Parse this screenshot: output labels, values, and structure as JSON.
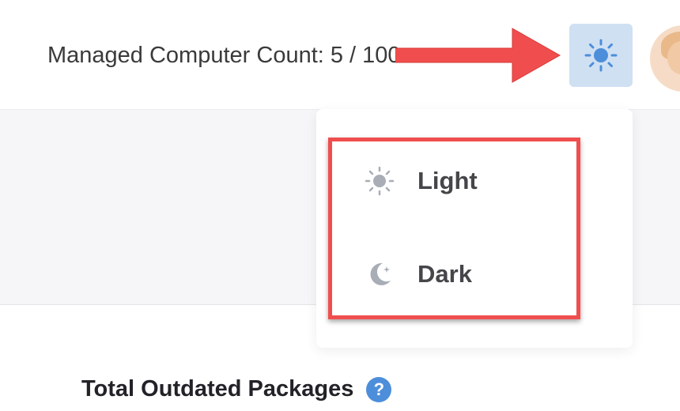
{
  "header": {
    "managed_count_label": "Managed Computer Count: 5 / 100",
    "theme_toggle_icon": "sun-icon",
    "avatar_icon": "user-avatar"
  },
  "theme_menu": {
    "items": [
      {
        "label": "Light",
        "icon": "sun-icon"
      },
      {
        "label": "Dark",
        "icon": "moon-icon"
      }
    ]
  },
  "main": {
    "section_title": "Total Outdated Packages",
    "help_icon": "?"
  },
  "annotation": {
    "arrow_color": "#f04e4e",
    "highlight_color": "#f04e4e"
  },
  "colors": {
    "theme_button_bg": "#cfe0f3",
    "accent_blue": "#4d8edb",
    "menu_text": "#45454a",
    "menu_icon": "#a8adb6"
  }
}
